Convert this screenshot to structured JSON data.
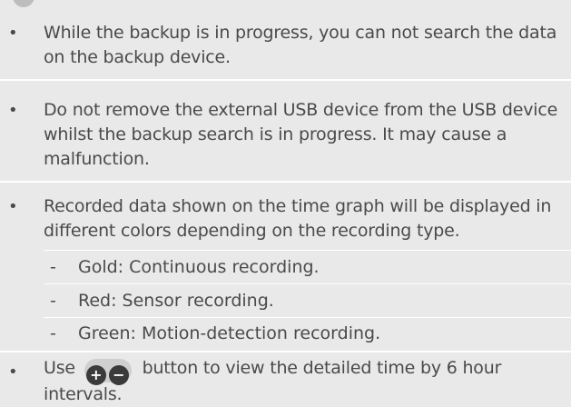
{
  "notes": [
    {
      "bullet": "•",
      "text": "While the backup is in progress, you can not search the data on the backup device."
    },
    {
      "bullet": "•",
      "text": "Do not remove the external USB device from the USB device whilst the backup search is in progress. It may cause a malfunction."
    },
    {
      "bullet": "•",
      "text": "Recorded data shown on the time graph will be displayed in different colors depending on the recording type.",
      "sub_items": [
        {
          "dash": "-",
          "text": "Gold: Continuous recording."
        },
        {
          "dash": "-",
          "text": "Red: Sensor recording."
        },
        {
          "dash": "-",
          "text": "Green: Motion-detection recording."
        }
      ]
    },
    {
      "bullet": "•",
      "text_before": "Use",
      "text_after": "button to view the detailed time by 6 hour intervals.",
      "icons": {
        "plus_icon": "+",
        "minus_icon": "−"
      }
    }
  ]
}
